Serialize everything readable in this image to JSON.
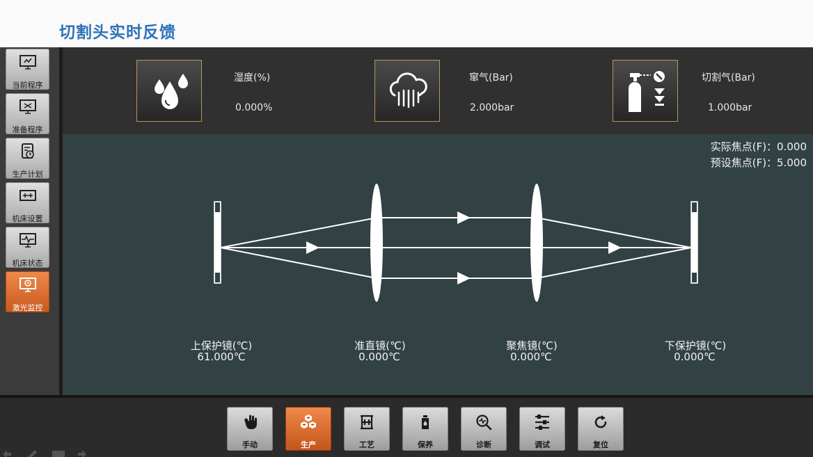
{
  "header": {
    "title": "切割头实时反馈"
  },
  "sidebar": {
    "items": [
      {
        "label": "当前程序",
        "icon": "monitor-program-icon",
        "active": false
      },
      {
        "label": "准备程序",
        "icon": "monitor-prepare-icon",
        "active": false
      },
      {
        "label": "生产计划",
        "icon": "schedule-icon",
        "active": false
      },
      {
        "label": "机床设置",
        "icon": "machine-settings-icon",
        "active": false
      },
      {
        "label": "机床状态",
        "icon": "machine-status-icon",
        "active": false
      },
      {
        "label": "激光监控",
        "icon": "laser-monitor-icon",
        "active": true
      }
    ]
  },
  "gauges": [
    {
      "label": "湿度(%)",
      "value": "0.000%",
      "icon": "water-drops-icon"
    },
    {
      "label": "窜气(Bar)",
      "value": "2.000bar",
      "icon": "cloud-steam-icon"
    },
    {
      "label": "切割气(Bar)",
      "value": "1.000bar",
      "icon": "gas-cylinder-icon"
    }
  ],
  "focus": {
    "actual": "实际焦点(F)：0.000",
    "preset": "预设焦点(F)：5.000"
  },
  "lenses": [
    {
      "label": "上保护镜(℃)",
      "value": "61.000℃"
    },
    {
      "label": "准直镜(℃)",
      "value": "0.000℃"
    },
    {
      "label": "聚焦镜(℃)",
      "value": "0.000℃"
    },
    {
      "label": "下保护镜(℃)",
      "value": "0.000℃"
    }
  ],
  "bottom_nav": [
    {
      "label": "手动",
      "icon": "hand-icon",
      "active": false
    },
    {
      "label": "生产",
      "icon": "boxes-icon",
      "active": true
    },
    {
      "label": "工艺",
      "icon": "process-icon",
      "active": false
    },
    {
      "label": "保养",
      "icon": "oil-can-icon",
      "active": false
    },
    {
      "label": "诊断",
      "icon": "diagnose-icon",
      "active": false
    },
    {
      "label": "调试",
      "icon": "debug-sliders-icon",
      "active": false
    },
    {
      "label": "复位",
      "icon": "reset-icon",
      "active": false
    }
  ],
  "colors": {
    "title": "#2d72b8",
    "accent": "#e0713a",
    "optics_bg": "#324143",
    "gauge_border": "#b8955a"
  }
}
